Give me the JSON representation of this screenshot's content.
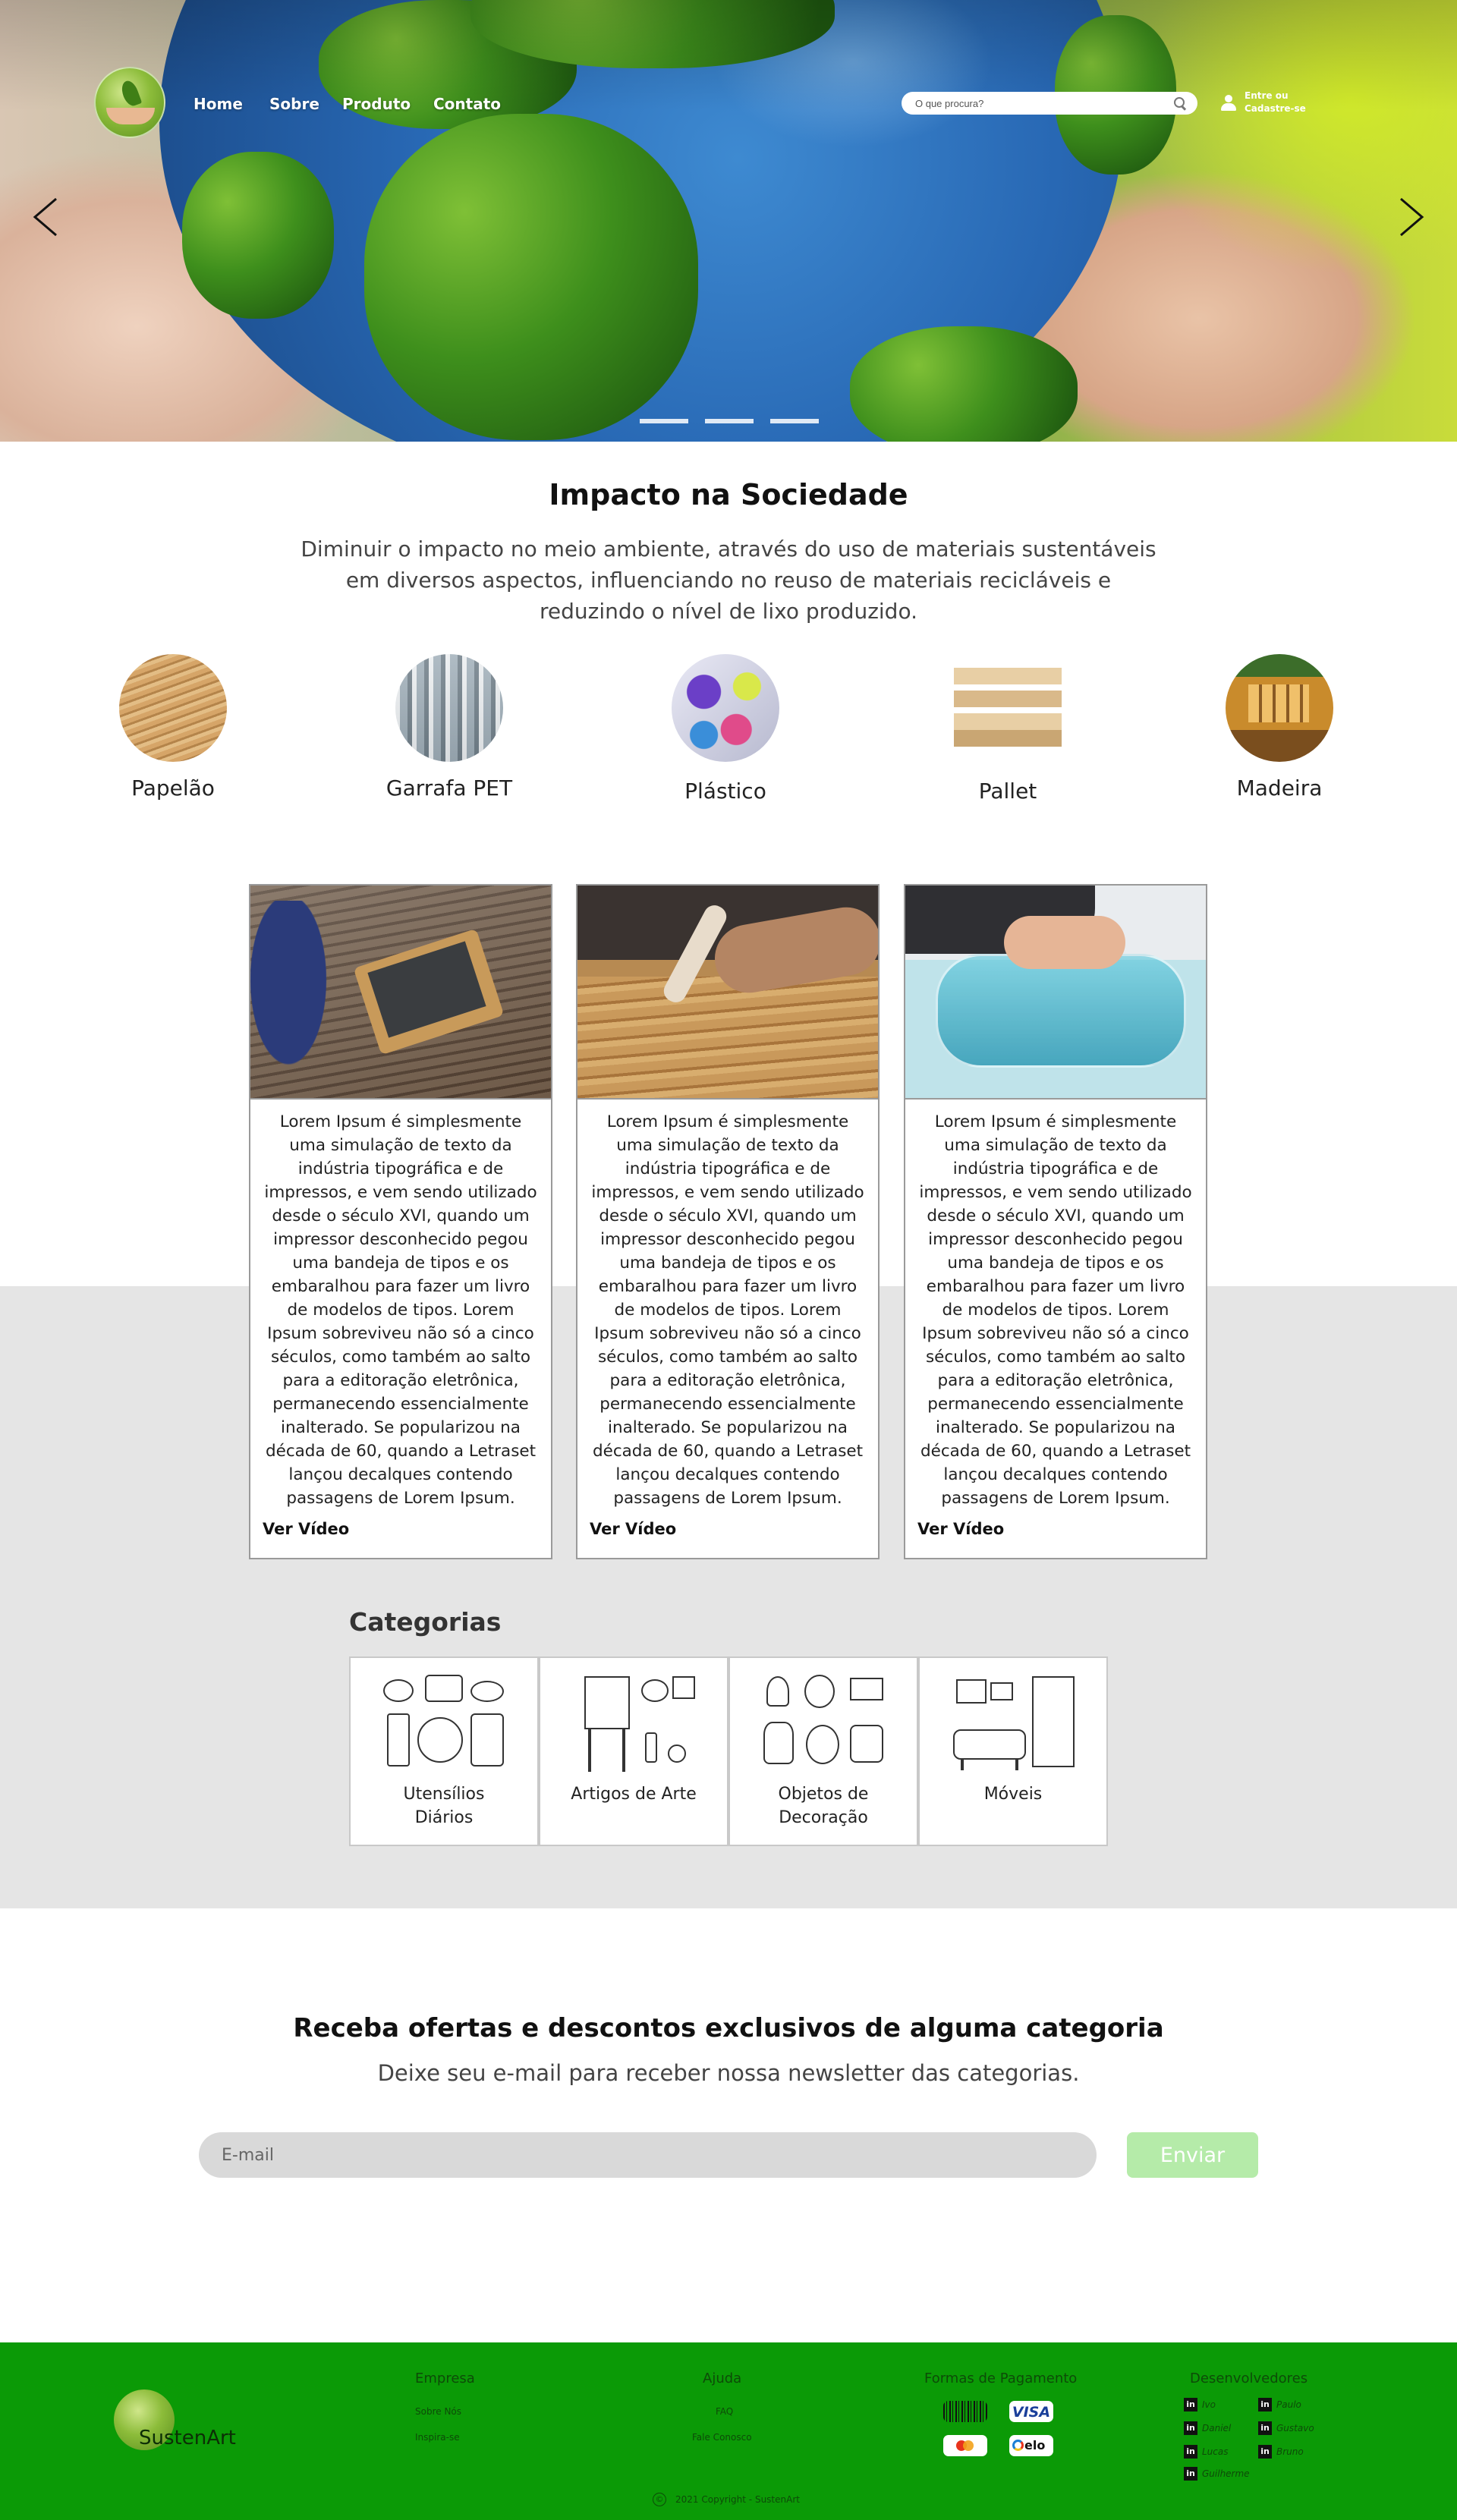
{
  "header": {
    "nav": [
      "Home",
      "Sobre",
      "Produto",
      "Contato"
    ],
    "search_placeholder": "O que procura?",
    "account_label": "Entre ou Cadastre-se"
  },
  "carousel": {
    "slides": 3,
    "active": 0
  },
  "impact": {
    "title": "Impacto na Sociedade",
    "text": "Diminuir o impacto no meio ambiente, através do uso de materiais sustentáveis em diversos aspectos, influenciando no reuso de materiais recicláveis e reduzindo o nível de lixo produzido.",
    "materials": [
      "Papelão",
      "Garrafa PET",
      "Plástico",
      "Pallet",
      "Madeira"
    ]
  },
  "cards": [
    {
      "text": "Lorem Ipsum é simplesmente uma simulação de texto da indústria tipográfica e de impressos, e vem sendo utilizado desde o século XVI, quando um impressor desconhecido pegou uma bandeja de tipos e os embaralhou para fazer um livro de modelos de tipos. Lorem Ipsum sobreviveu não só a cinco séculos, como também ao salto para a editoração eletrônica, permanecendo essencialmente inalterado. Se popularizou na década de 60, quando a Letraset lançou decalques contendo passagens de Lorem Ipsum.",
      "link": "Ver Vídeo"
    },
    {
      "text": "Lorem Ipsum é simplesmente uma simulação de texto da indústria tipográfica e de impressos, e vem sendo utilizado desde o século XVI, quando um impressor desconhecido pegou uma bandeja de tipos e os embaralhou para fazer um livro de modelos de tipos. Lorem Ipsum sobreviveu não só a cinco séculos, como também ao salto para a editoração eletrônica, permanecendo essencialmente inalterado. Se popularizou na década de 60, quando a Letraset lançou decalques contendo passagens de Lorem Ipsum.",
      "link": "Ver Vídeo"
    },
    {
      "text": "Lorem Ipsum é simplesmente uma simulação de texto da indústria tipográfica e de impressos, e vem sendo utilizado desde o século XVI, quando um impressor desconhecido pegou uma bandeja de tipos e os embaralhou para fazer um livro de modelos de tipos. Lorem Ipsum sobreviveu não só a cinco séculos, como também ao salto para a editoração eletrônica, permanecendo essencialmente inalterado. Se popularizou na década de 60, quando a Letraset lançou decalques contendo passagens de Lorem Ipsum.",
      "link": "Ver Vídeo"
    }
  ],
  "categories": {
    "title": "Categorias",
    "items": [
      "Utensílios Diários",
      "Artigos de Arte",
      "Objetos de Decoração",
      "Móveis"
    ]
  },
  "newsletter": {
    "title": "Receba ofertas e descontos exclusivos de alguma categoria",
    "subtitle": "Deixe seu e-mail para receber nossa newsletter das categorias.",
    "email_placeholder": "E-mail",
    "button": "Enviar"
  },
  "footer": {
    "brand": "SustenArt",
    "empresa": {
      "title": "Empresa",
      "links": [
        "Sobre Nós",
        "Inspira-se"
      ]
    },
    "ajuda": {
      "title": "Ajuda",
      "links": [
        "FAQ",
        "Fale Conosco"
      ]
    },
    "pagamento": {
      "title": "Formas de Pagamento",
      "visa": "VISA",
      "elo": "elo"
    },
    "devs": {
      "title": "Desenvolvedores",
      "names": [
        "Ivo",
        "Paulo",
        "Daniel",
        "Gustavo",
        "Lucas",
        "Bruno",
        "Guilherme"
      ]
    },
    "copyright": "2021 Copyright - SustenArt"
  },
  "colors": {
    "footer_green": "#0b9a06",
    "send_button": "#b5eba9",
    "grey_band": "#e5e5e5"
  }
}
